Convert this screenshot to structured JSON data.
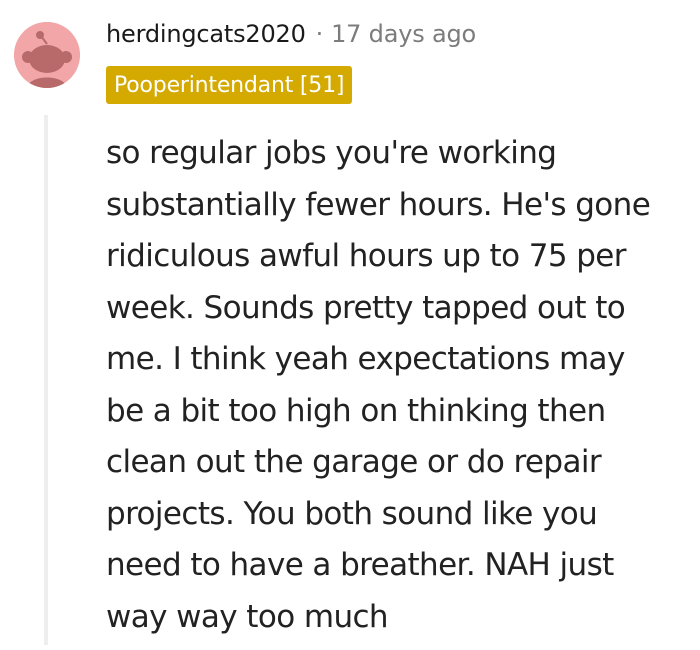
{
  "comment": {
    "username": "herdingcats2020",
    "separator": "·",
    "timestamp": "17 days ago",
    "flair": "Pooperintendant [51]",
    "body_lines": [
      "so regular jobs you're working",
      "substantially fewer hours. He's gone",
      "ridiculous awful hours up to 75 per",
      "week. Sounds pretty tapped out to",
      "me. I think yeah expectations may",
      "be a bit too high on thinking then",
      "clean out the garage or do repair",
      "projects. You both sound like you",
      "need to have a breather. NAH just",
      "way way too much"
    ]
  },
  "colors": {
    "avatar_background": "#f2a6a7",
    "flair_background": "#d4a900",
    "flair_text": "#ffffff",
    "username_text": "#1a1a1b",
    "meta_text": "#7c7c7c",
    "body_text": "#222222",
    "thread_line": "#eeeeee"
  },
  "icons": {
    "avatar": "snoo-avatar-icon"
  }
}
